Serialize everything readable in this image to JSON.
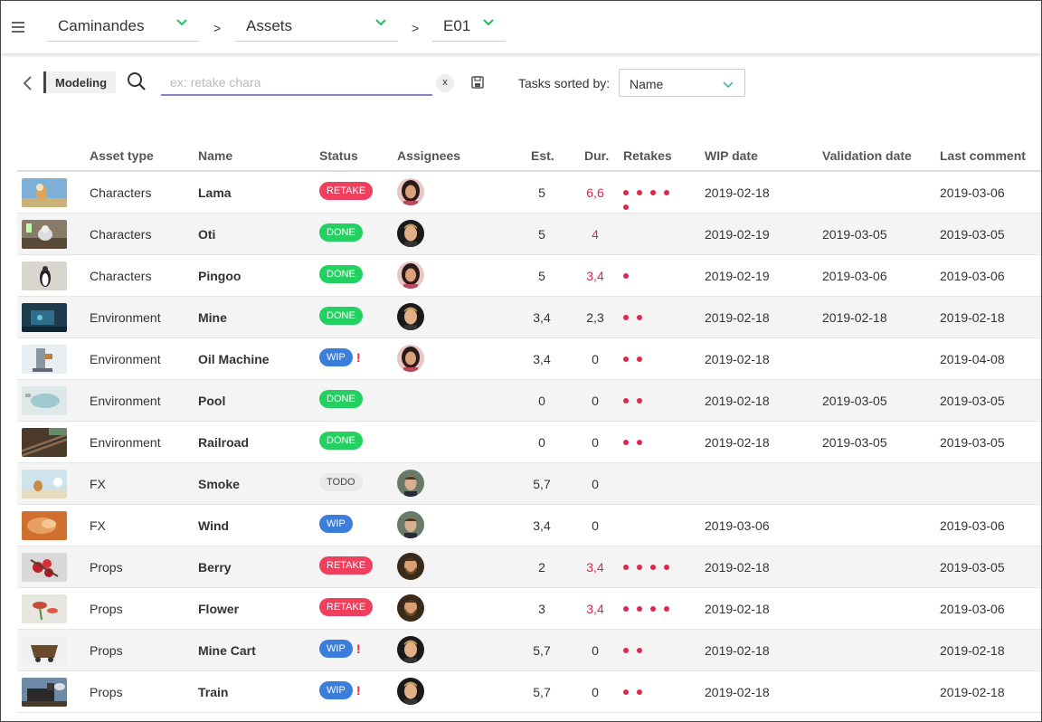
{
  "nav": {
    "production": "Caminandes",
    "section": "Assets",
    "episode": "E01",
    "separator": ">"
  },
  "toolbar": {
    "task_type": "Modeling",
    "search_placeholder": "ex: retake chara",
    "search_value": "",
    "clear_label": "x",
    "sort_label": "Tasks sorted by:",
    "sort_value": "Name"
  },
  "columns": {
    "asset_type": "Asset type",
    "name": "Name",
    "status": "Status",
    "assignees": "Assignees",
    "est": "Est.",
    "dur": "Dur.",
    "retakes": "Retakes",
    "wip_date": "WIP date",
    "validation_date": "Validation date",
    "last_comment": "Last comment"
  },
  "colors": {
    "retake": "#f03e5d",
    "done": "#22d160",
    "wip": "#3b7ddd",
    "todo": "#eaeaea",
    "alert": "#e0264a"
  },
  "rows": [
    {
      "type": "Characters",
      "name": "Lama",
      "status": "RETAKE",
      "status_kind": "retake",
      "alert": "",
      "assignee": "female",
      "est": "5",
      "dur": "6,6",
      "dur_alert": true,
      "retakes": 5,
      "wip": "2019-02-18",
      "validation": "",
      "last": "2019-03-06",
      "thumb": "lama"
    },
    {
      "type": "Characters",
      "name": "Oti",
      "status": "DONE",
      "status_kind": "done",
      "alert": "",
      "assignee": "male-a",
      "est": "5",
      "dur": "4",
      "dur_alert": true,
      "retakes": 0,
      "wip": "2019-02-19",
      "validation": "2019-03-05",
      "last": "2019-03-05",
      "thumb": "oti"
    },
    {
      "type": "Characters",
      "name": "Pingoo",
      "status": "DONE",
      "status_kind": "done",
      "alert": "",
      "assignee": "female",
      "est": "5",
      "dur": "3,4",
      "dur_alert": true,
      "retakes": 1,
      "wip": "2019-02-19",
      "validation": "2019-03-06",
      "last": "2019-03-06",
      "thumb": "pingoo"
    },
    {
      "type": "Environment",
      "name": "Mine",
      "status": "DONE",
      "status_kind": "done",
      "alert": "",
      "assignee": "male-a",
      "est": "3,4",
      "dur": "2,3",
      "dur_alert": false,
      "retakes": 2,
      "wip": "2019-02-18",
      "validation": "2019-02-18",
      "last": "2019-02-18",
      "thumb": "mine"
    },
    {
      "type": "Environment",
      "name": "Oil Machine",
      "status": "WIP",
      "status_kind": "wip",
      "alert": "!",
      "assignee": "female",
      "est": "3,4",
      "dur": "0",
      "dur_alert": false,
      "retakes": 2,
      "wip": "2019-02-18",
      "validation": "",
      "last": "2019-04-08",
      "thumb": "oil"
    },
    {
      "type": "Environment",
      "name": "Pool",
      "status": "DONE",
      "status_kind": "done",
      "alert": "",
      "assignee": "",
      "est": "0",
      "dur": "0",
      "dur_alert": false,
      "retakes": 2,
      "wip": "2019-02-18",
      "validation": "2019-03-05",
      "last": "2019-03-05",
      "thumb": "pool"
    },
    {
      "type": "Environment",
      "name": "Railroad",
      "status": "DONE",
      "status_kind": "done",
      "alert": "",
      "assignee": "",
      "est": "0",
      "dur": "0",
      "dur_alert": false,
      "retakes": 2,
      "wip": "2019-02-18",
      "validation": "2019-03-05",
      "last": "2019-03-05",
      "thumb": "railroad"
    },
    {
      "type": "FX",
      "name": "Smoke",
      "status": "TODO",
      "status_kind": "todo",
      "alert": "",
      "assignee": "male-b",
      "est": "5,7",
      "dur": "0",
      "dur_alert": false,
      "retakes": 0,
      "wip": "",
      "validation": "",
      "last": "",
      "thumb": "smoke"
    },
    {
      "type": "FX",
      "name": "Wind",
      "status": "WIP",
      "status_kind": "wip",
      "alert": "",
      "assignee": "male-b",
      "est": "3,4",
      "dur": "0",
      "dur_alert": false,
      "retakes": 0,
      "wip": "2019-03-06",
      "validation": "",
      "last": "2019-03-06",
      "thumb": "wind"
    },
    {
      "type": "Props",
      "name": "Berry",
      "status": "RETAKE",
      "status_kind": "retake",
      "alert": "",
      "assignee": "male-c",
      "est": "2",
      "dur": "3,4",
      "dur_alert": true,
      "retakes": 4,
      "wip": "2019-02-18",
      "validation": "",
      "last": "2019-03-05",
      "thumb": "berry"
    },
    {
      "type": "Props",
      "name": "Flower",
      "status": "RETAKE",
      "status_kind": "retake",
      "alert": "",
      "assignee": "male-c",
      "est": "3",
      "dur": "3,4",
      "dur_alert": true,
      "retakes": 4,
      "wip": "2019-02-18",
      "validation": "",
      "last": "2019-03-06",
      "thumb": "flower"
    },
    {
      "type": "Props",
      "name": "Mine Cart",
      "status": "WIP",
      "status_kind": "wip",
      "alert": "!",
      "assignee": "male-a",
      "est": "5,7",
      "dur": "0",
      "dur_alert": false,
      "retakes": 2,
      "wip": "2019-02-18",
      "validation": "",
      "last": "2019-02-18",
      "thumb": "minecart"
    },
    {
      "type": "Props",
      "name": "Train",
      "status": "WIP",
      "status_kind": "wip",
      "alert": "!",
      "assignee": "male-a",
      "est": "5,7",
      "dur": "0",
      "dur_alert": false,
      "retakes": 2,
      "wip": "2019-02-18",
      "validation": "",
      "last": "2019-02-18",
      "thumb": "train"
    }
  ]
}
